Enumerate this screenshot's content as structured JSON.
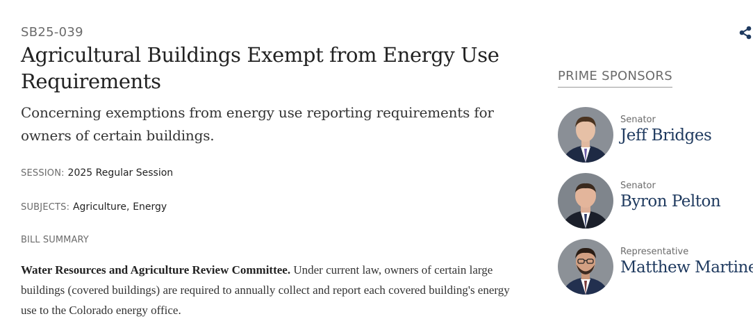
{
  "bill": {
    "id": "SB25-039",
    "title": "Agricultural Buildings Exempt from Energy Use Requirements",
    "subtitle": "Concerning exemptions from energy use reporting requirements for owners of certain buildings."
  },
  "session": {
    "label": "SESSION:",
    "value": "2025 Regular Session"
  },
  "subjects": {
    "label": "SUBJECTS:",
    "items": [
      "Agriculture,",
      "Energy"
    ]
  },
  "summary": {
    "heading": "BILL SUMMARY",
    "lead": "Water Resources and Agriculture Review Committee.",
    "text": " Under current law, owners of certain large buildings (covered buildings) are required to annually collect and report each covered building's energy use to the Colorado energy office."
  },
  "sponsors": {
    "heading": "PRIME SPONSORS",
    "items": [
      {
        "role": "Senator",
        "name": "Jeff Bridges"
      },
      {
        "role": "Senator",
        "name": "Byron Pelton"
      },
      {
        "role": "Representative",
        "name": "Matthew Martinez"
      }
    ]
  },
  "icons": {
    "share": "share-icon"
  },
  "colors": {
    "sponsor_name": "#1f3a5f",
    "label_gray": "#6b6b6b",
    "share_icon": "#1f3a5f"
  }
}
